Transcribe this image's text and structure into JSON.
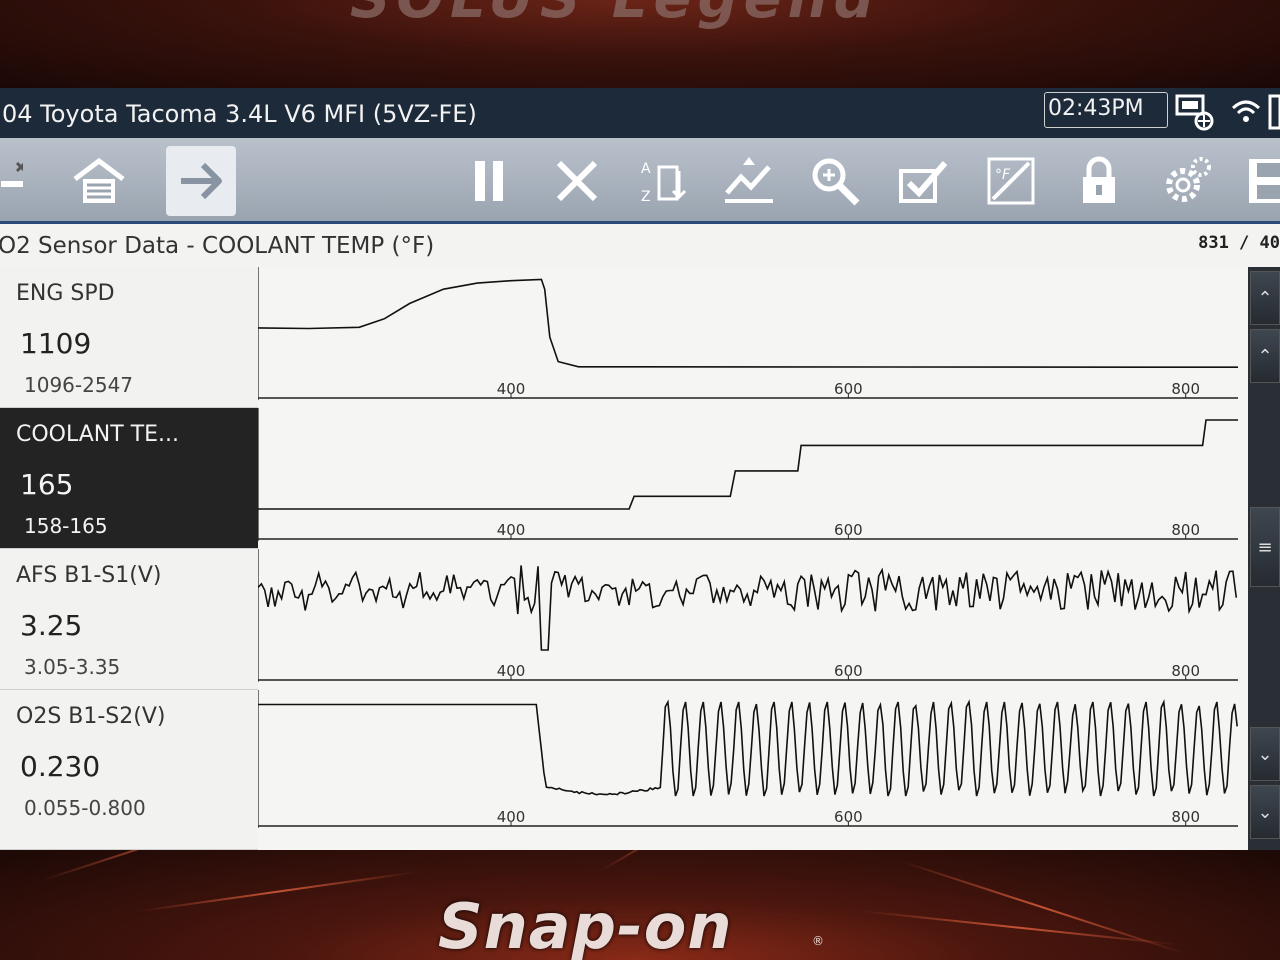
{
  "bezel": {
    "brand": "Snap-on",
    "reg_mark": "®"
  },
  "titlebar": {
    "vehicle": "04 Toyota Tacoma 3.4L V6 MFI (5VZ-FE)",
    "time": "02:43PM"
  },
  "toolbar": {
    "buttons": [
      {
        "name": "close-x",
        "icon": "close-x-icon"
      },
      {
        "name": "home",
        "icon": "garage-home-icon"
      },
      {
        "name": "next",
        "icon": "arrow-right-icon",
        "active": true
      },
      {
        "name": "pause",
        "icon": "pause-icon"
      },
      {
        "name": "clear",
        "icon": "x-icon"
      },
      {
        "name": "sort",
        "icon": "sort-az-icon"
      },
      {
        "name": "graph-mode",
        "icon": "graph-icon"
      },
      {
        "name": "zoom",
        "icon": "zoom-icon"
      },
      {
        "name": "select",
        "icon": "checkbox-icon"
      },
      {
        "name": "units",
        "icon": "units-icon"
      },
      {
        "name": "lock",
        "icon": "lock-icon"
      },
      {
        "name": "settings",
        "icon": "gear-icon"
      },
      {
        "name": "save",
        "icon": "save-icon"
      }
    ]
  },
  "header": {
    "title": "O2 Sensor Data - COOLANT TEMP (°F)",
    "counter": "831 / 40"
  },
  "x_axis": {
    "ticks": [
      "400",
      "600",
      "800"
    ]
  },
  "parameters": [
    {
      "name": "ENG SPD",
      "value": "1109",
      "range": "1096-2547",
      "selected": false
    },
    {
      "name": "COOLANT TE...",
      "value": "165",
      "range": "158-165",
      "selected": true
    },
    {
      "name": "AFS B1-S1(V)",
      "value": "3.25",
      "range": "3.05-3.35",
      "selected": false
    },
    {
      "name": "O2S B1-S2(V)",
      "value": "0.230",
      "range": "0.055-0.800",
      "selected": false
    }
  ],
  "chart_data": {
    "type": "line",
    "x_range": [
      250,
      831
    ],
    "series": [
      {
        "name": "ENG SPD",
        "unit": "",
        "range": [
          1096,
          2547
        ],
        "points": [
          [
            250,
            1750
          ],
          [
            280,
            1740
          ],
          [
            310,
            1760
          ],
          [
            325,
            1900
          ],
          [
            340,
            2150
          ],
          [
            360,
            2380
          ],
          [
            380,
            2480
          ],
          [
            400,
            2520
          ],
          [
            418,
            2540
          ],
          [
            420,
            2380
          ],
          [
            423,
            1600
          ],
          [
            428,
            1200
          ],
          [
            440,
            1115
          ],
          [
            831,
            1109
          ]
        ]
      },
      {
        "name": "COOLANT TE...",
        "unit": "°F",
        "range": [
          158,
          165
        ],
        "points": [
          [
            250,
            158
          ],
          [
            470,
            158
          ],
          [
            473,
            159
          ],
          [
            530,
            159
          ],
          [
            533,
            161
          ],
          [
            570,
            161
          ],
          [
            572,
            163
          ],
          [
            810,
            163
          ],
          [
            812,
            165
          ],
          [
            831,
            165
          ]
        ]
      },
      {
        "name": "AFS B1-S1(V)",
        "unit": "V",
        "range": [
          3.05,
          3.35
        ],
        "pattern": "oscillating",
        "base": 3.25,
        "dip_at": 420,
        "dip_value": 3.05
      },
      {
        "name": "O2S B1-S2(V)",
        "unit": "V",
        "range": [
          0.055,
          0.8
        ],
        "pattern": "oscillating",
        "high_until": 415,
        "low_segment": [
          420,
          485
        ],
        "oscillate_from": 490,
        "current": 0.23
      }
    ]
  }
}
